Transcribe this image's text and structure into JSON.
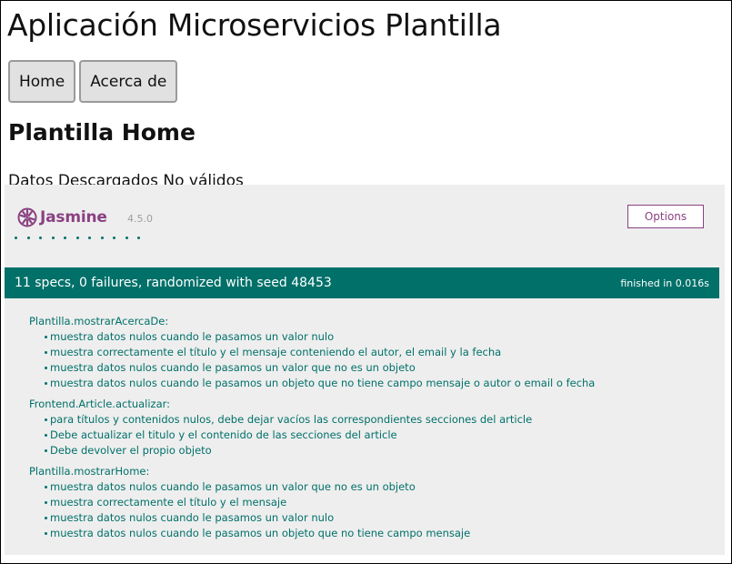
{
  "app": {
    "title": "Aplicación Microservicios Plantilla"
  },
  "nav": {
    "items": [
      {
        "label": "Home"
      },
      {
        "label": "Acerca de"
      }
    ]
  },
  "page": {
    "heading": "Plantilla Home",
    "status": "Datos Descargados No válidos"
  },
  "jasmine": {
    "brand": "Jasmine",
    "version": "4.5.0",
    "options_label": "Options",
    "dot_count": 11,
    "summary": "11 specs, 0 failures, randomized with seed 48453",
    "duration": "finished in 0.016s",
    "suites": [
      {
        "name": "Plantilla.mostrarAcercaDe:",
        "specs": [
          "muestra datos nulos cuando le pasamos un valor nulo",
          "muestra correctamente el título y el mensaje conteniendo el autor, el email y la fecha",
          "muestra datos nulos cuando le pasamos un valor que no es un objeto",
          "muestra datos nulos cuando le pasamos un objeto que no tiene campo mensaje o autor o email o fecha"
        ]
      },
      {
        "name": "Frontend.Article.actualizar:",
        "specs": [
          "para títulos y contenidos nulos, debe dejar vacíos las correspondientes secciones del article",
          "Debe actualizar el titulo y el contenido de las secciones del article",
          "Debe devolver el propio objeto"
        ]
      },
      {
        "name": "Plantilla.mostrarHome:",
        "specs": [
          "muestra datos nulos cuando le pasamos un valor que no es un objeto",
          "muestra correctamente el título y el mensaje",
          "muestra datos nulos cuando le pasamos un valor nulo",
          "muestra datos nulos cuando le pasamos un objeto que no tiene campo mensaje"
        ]
      }
    ]
  },
  "colors": {
    "jasmine_purple": "#8a4182",
    "jasmine_green": "#007069",
    "panel_bg": "#eeeeee"
  }
}
